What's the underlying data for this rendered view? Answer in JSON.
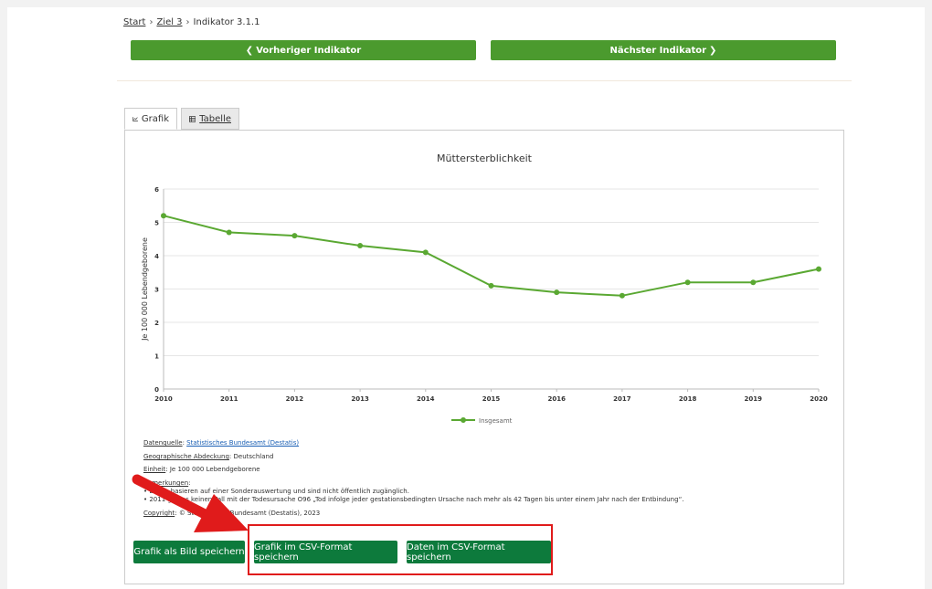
{
  "breadcrumb": {
    "start": "Start",
    "goal": "Ziel 3",
    "current": "Indikator 3.1.1",
    "separator": "›"
  },
  "nav": {
    "prev_label": "Vorheriger Indikator",
    "next_label": "Nächster Indikator",
    "prev_icon": "chevron-left-icon",
    "next_icon": "chevron-right-icon"
  },
  "tabs": [
    {
      "label": "Grafik",
      "icon": "line-chart-icon",
      "active": true
    },
    {
      "label": "Tabelle",
      "icon": "table-icon",
      "active": false
    }
  ],
  "chart_data": {
    "type": "line",
    "title": "Müttersterblichkeit",
    "ylabel": "Je 100 000 Lebendgeborene",
    "xlabel": "",
    "x": [
      "2010",
      "2011",
      "2012",
      "2013",
      "2014",
      "2015",
      "2016",
      "2017",
      "2018",
      "2019",
      "2020"
    ],
    "ylim": [
      0,
      6
    ],
    "yticks": [
      "0",
      "1",
      "2",
      "3",
      "4",
      "5",
      "6"
    ],
    "grid": true,
    "legend": "bottom",
    "series": [
      {
        "name": "Insgesamt",
        "color": "#5aa832",
        "values": [
          5.2,
          4.7,
          4.6,
          4.3,
          4.1,
          3.1,
          2.9,
          2.8,
          3.2,
          3.2,
          3.6
        ]
      }
    ]
  },
  "meta": {
    "source_label": "Datenquelle",
    "source_value": "Statistisches Bundesamt (Destatis)",
    "geo_label": "Geographische Abdeckung",
    "geo_value": "Deutschland",
    "unit_label": "Einheit",
    "unit_value": "Je 100 000 Lebendgeborene",
    "notes_label": "Anmerkungen",
    "note1": "• Daten basieren auf einer Sonderauswertung und sind nicht öffentlich zugänglich.",
    "note2": "• 2011 gab es keinen Fall mit der Todesursache O96 „Tod infolge jeder gestationsbedingten Ursache nach mehr als 42 Tagen bis unter einem Jahr nach der Entbindung“.",
    "copyright_label": "Copyright",
    "copyright_value": "© Statistisches Bundesamt (Destatis), 2023"
  },
  "buttons": {
    "save_image": "Grafik als Bild speichern",
    "save_chart_csv": "Grafik im CSV-Format speichern",
    "save_data_csv": "Daten im CSV-Format speichern"
  },
  "colors": {
    "green_nav": "#4b9a2e",
    "green_button": "#0d7a3c",
    "highlight_red": "#e01b1b",
    "series": "#5aa832"
  }
}
